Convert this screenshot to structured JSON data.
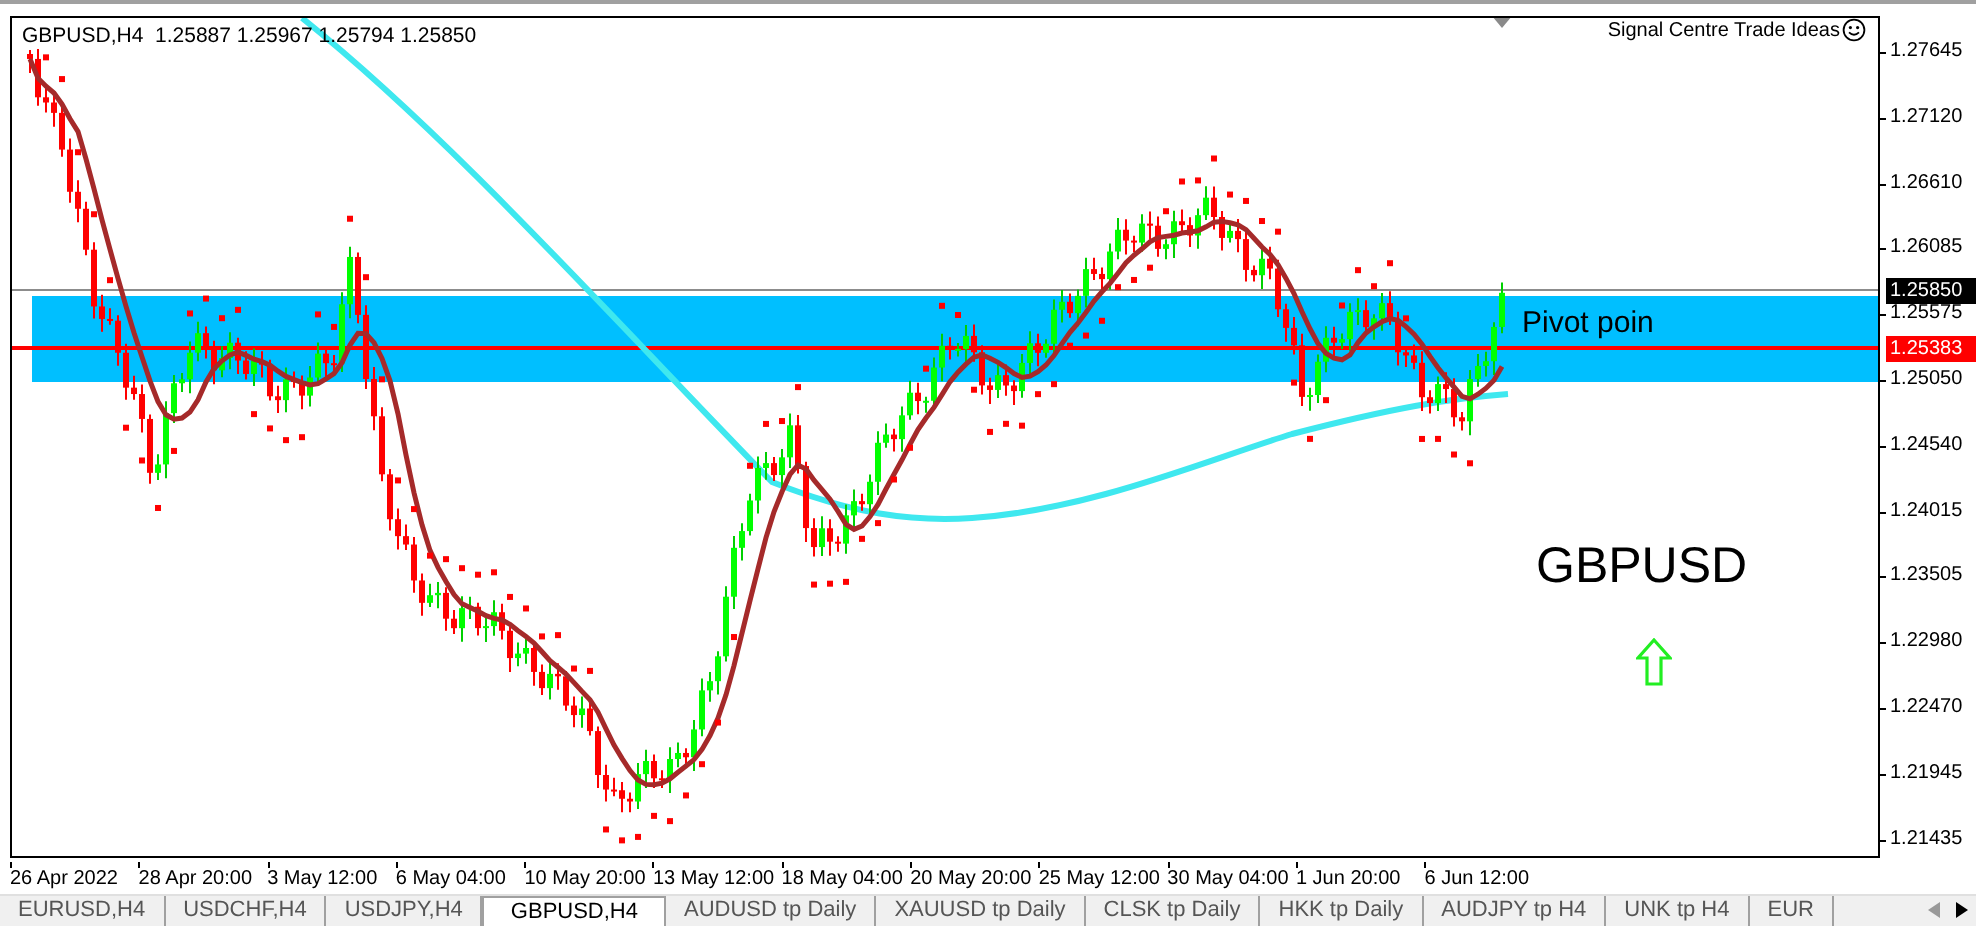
{
  "chart": {
    "symbol": "GBPUSD,H4",
    "quotes": [
      "1.25887",
      "1.25967",
      "1.25794",
      "1.25850"
    ],
    "signature": "Signal Centre Trade Ideas",
    "zone_label": "Pivot poin",
    "symbol_label": "GBPUSD"
  },
  "price_axis": {
    "ticks": [
      "1.27645",
      "1.27120",
      "1.26610",
      "1.26085",
      "1.25575",
      "1.25050",
      "1.24540",
      "1.24015",
      "1.23505",
      "1.22980",
      "1.22470",
      "1.21945",
      "1.21435"
    ],
    "markers": [
      {
        "kind": "current",
        "text": "1.25850"
      },
      {
        "kind": "pivot",
        "text": "1.25383"
      }
    ]
  },
  "time_axis": {
    "labels": [
      "26 Apr 2022",
      "28 Apr 20:00",
      "3 May 12:00",
      "6 May 04:00",
      "10 May 20:00",
      "13 May 12:00",
      "18 May 04:00",
      "20 May 20:00",
      "25 May 12:00",
      "30 May 04:00",
      "1 Jun 20:00",
      "6 Jun 12:00"
    ]
  },
  "tabs": [
    {
      "label": "EURUSD,H4",
      "selected": false
    },
    {
      "label": "USDCHF,H4",
      "selected": false
    },
    {
      "label": "USDJPY,H4",
      "selected": false
    },
    {
      "label": "GBPUSD,H4",
      "selected": true
    },
    {
      "label": "AUDUSD tp Daily",
      "selected": false
    },
    {
      "label": "XAUUSD tp Daily",
      "selected": false
    },
    {
      "label": "CLSK tp Daily",
      "selected": false
    },
    {
      "label": "HKK tp Daily",
      "selected": false
    },
    {
      "label": "AUDJPY tp H4",
      "selected": false
    },
    {
      "label": "UNK tp H4",
      "selected": false
    },
    {
      "label": "EUR",
      "selected": false
    }
  ]
}
